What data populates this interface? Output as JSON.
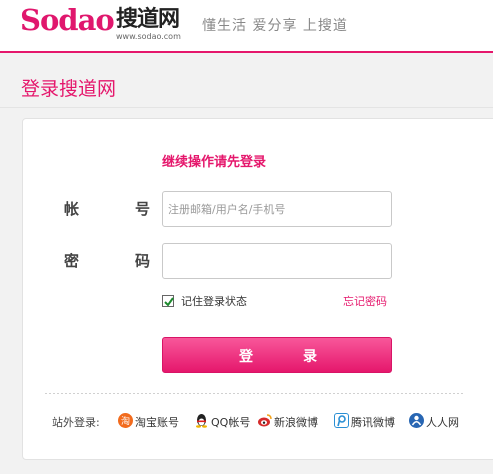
{
  "header": {
    "logo_text": "Sodao",
    "logo_cn": "搜道网",
    "logo_url": "www.sodao.com",
    "slogan": "懂生活  爱分享  上搜道"
  },
  "page": {
    "title": "登录搜道网"
  },
  "form": {
    "prompt": "继续操作请先登录",
    "account_label_1": "帐",
    "account_label_2": "号",
    "account_placeholder": "注册邮箱/用户名/手机号",
    "account_value": "",
    "password_label_1": "密",
    "password_label_2": "码",
    "password_value": "",
    "remember_label": "记住登录状态",
    "remember_checked": true,
    "forgot_link": "忘记密码",
    "login_label_1": "登",
    "login_label_2": "录"
  },
  "external_login": {
    "label": "站外登录:",
    "providers": [
      {
        "name": "淘宝账号",
        "icon": "taobao-icon",
        "color": "#f26b1d"
      },
      {
        "name": "QQ帐号",
        "icon": "qq-icon",
        "color": "#222222"
      },
      {
        "name": "新浪微博",
        "icon": "weibo-icon",
        "color": "#d52b2b"
      },
      {
        "name": "腾讯微博",
        "icon": "tencent-weibo-icon",
        "color": "#2a8fd4"
      },
      {
        "name": "人人网",
        "icon": "renren-icon",
        "color": "#2866b3"
      }
    ]
  },
  "colors": {
    "accent": "#e5176c",
    "background": "#f2f2f2"
  }
}
